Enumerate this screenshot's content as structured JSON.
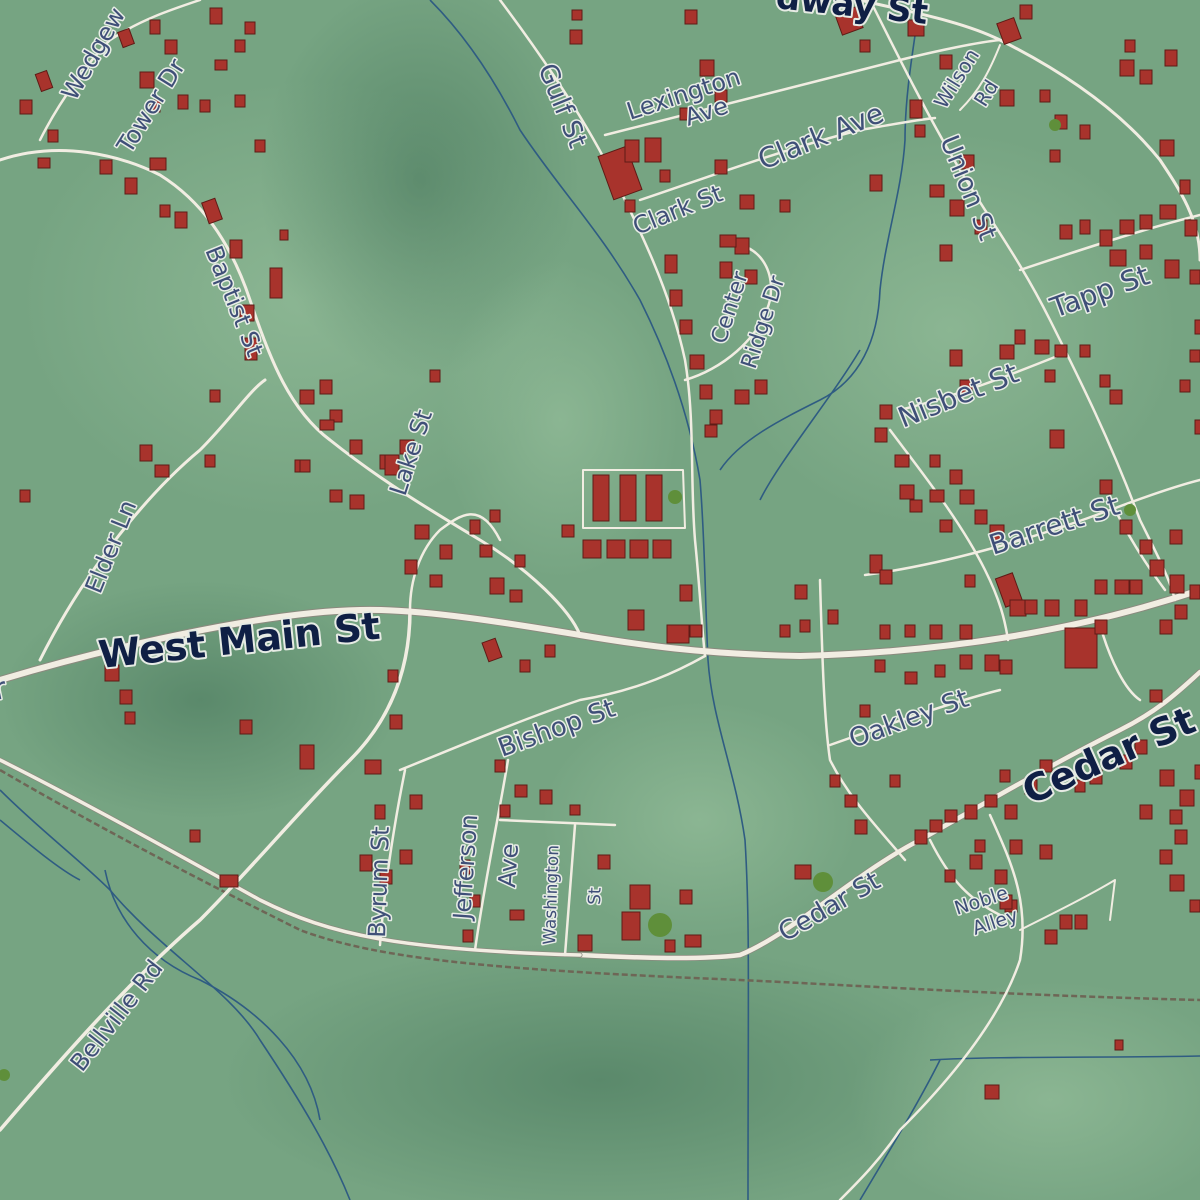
{
  "map": {
    "colors": {
      "land": "#78a684",
      "land_dark": "#5c8a6c",
      "road": "#f1ede2",
      "building": "#a8332c",
      "stream": "#2f5c82",
      "label": "#3f4f78",
      "label_major": "#0f1f45",
      "rail": "#6e6656"
    },
    "labels": {
      "west_main": "West Main St",
      "cedar_upper": "Cedar St",
      "cedar_lower": "Cedar St",
      "broadway_partial": "dway St",
      "wedgewood_partial": "Wedgew",
      "tower": "Tower Dr",
      "baptist": "Baptist St",
      "lake": "Lake St",
      "elder": "Elder Ln",
      "gulf": "Gulf St",
      "lexington_1": "Lexington",
      "lexington_2": "Ave",
      "clark_ave": "Clark Ave",
      "clark_st": "Clark St",
      "center": "Center",
      "ridge": "Ridge Dr",
      "wilson_1": "Wilson",
      "wilson_2": "Rd",
      "union": "Union St",
      "tapp": "Tapp St",
      "nisbet": "Nisbet St",
      "barrett": "Barrett St",
      "oakley": "Oakley St",
      "bishop": "Bishop St",
      "byrum": "Byrum St",
      "jefferson_1": "Jefferson",
      "jefferson_2": "Ave",
      "washington_1": "Washington",
      "washington_2": "St",
      "noble_1": "Noble",
      "noble_2": "Alley",
      "bellville": "Bellville Rd",
      "edge_left": "r"
    }
  }
}
